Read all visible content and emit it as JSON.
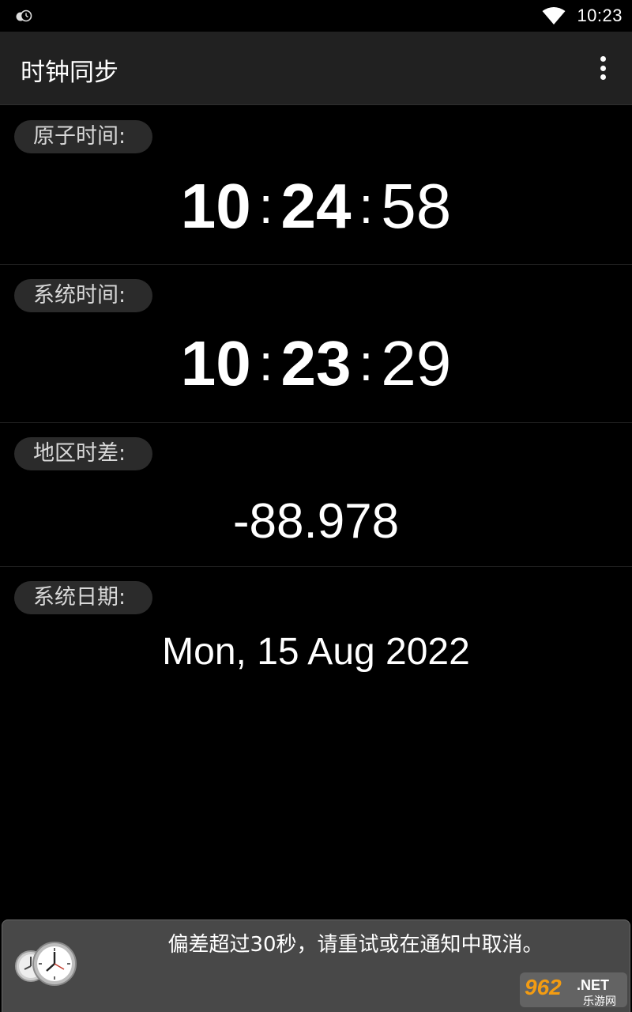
{
  "status_bar": {
    "left_icon": "clock-sync-notification-icon",
    "wifi_icon": "wifi-icon",
    "time": "10:23"
  },
  "app_bar": {
    "title": "时钟同步",
    "menu_icon": "overflow-menu-icon"
  },
  "atomic_time": {
    "label": "原子时间:",
    "hours": "10",
    "minutes": "24",
    "seconds": "58",
    "separator": ":"
  },
  "system_time": {
    "label": "系统时间:",
    "hours": "10",
    "minutes": "23",
    "seconds": "29",
    "separator": ":"
  },
  "offset": {
    "label": "地区时差:",
    "value": "-88.978"
  },
  "system_date": {
    "label": "系统日期:",
    "value": "Mon, 15 Aug 2022"
  },
  "toast": {
    "message": "偏差超过30秒，请重试或在通知中取消。",
    "icon": "clocks-icon"
  },
  "watermark": {
    "brand": "962",
    "net": ".NET",
    "sub": "乐游网"
  }
}
